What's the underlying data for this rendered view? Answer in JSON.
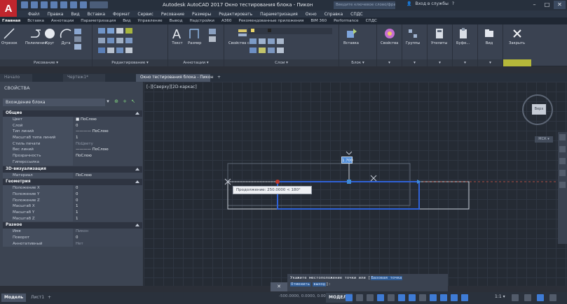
{
  "app": {
    "logo_letter": "A",
    "title": "Autodesk AutoCAD 2017   Окно тестирования блока - Пикон",
    "search_placeholder": "Введите ключевое слово/фразу",
    "signin": "Вход в службы",
    "window_controls": [
      "–",
      "□",
      "✕"
    ]
  },
  "menubar": [
    "Файл",
    "Правка",
    "Вид",
    "Вставка",
    "Формат",
    "Сервис",
    "Рисование",
    "Размеры",
    "Редактировать",
    "Параметризация",
    "Окно",
    "Справка",
    "СПДС"
  ],
  "ribbon_tabs": [
    {
      "label": "Главная",
      "active": true
    },
    {
      "label": "Вставка",
      "active": false
    },
    {
      "label": "Аннотации",
      "active": false
    },
    {
      "label": "Параметризация",
      "active": false
    },
    {
      "label": "Вид",
      "active": false
    },
    {
      "label": "Управление",
      "active": false
    },
    {
      "label": "Вывод",
      "active": false
    },
    {
      "label": "Надстройки",
      "active": false
    },
    {
      "label": "A360",
      "active": false
    },
    {
      "label": "Рекомендованные приложения",
      "active": false
    },
    {
      "label": "BIM 360",
      "active": false
    },
    {
      "label": "Performance",
      "active": false
    },
    {
      "label": "СПДС",
      "active": false
    }
  ],
  "ribbon": {
    "buttons": {
      "line": "Отрезок",
      "polyline": "Полилиния",
      "circle": "Круг",
      "arc": "Дуга",
      "text": "Текст",
      "dimension": "Размер",
      "properties": "Свойства слоя",
      "insert": "Вставка",
      "props_big": "Свойства",
      "groups": "Группы",
      "utilities": "Утилиты",
      "clipboard": "Буфе...",
      "view": "Вид",
      "close": "Закрыть"
    },
    "panels": {
      "draw": "Рисование ▾",
      "modify": "Редактирование ▾",
      "annotation": "Аннотации ▾",
      "layers": "Слои ▾",
      "block": "Блок ▾"
    }
  },
  "filetabs": [
    {
      "label": "Начало",
      "active": false
    },
    {
      "label": "Чертеж1*",
      "active": false
    },
    {
      "label": "Окно тестирования блока - Пикон",
      "active": true
    },
    {
      "label": "+",
      "active": false
    }
  ],
  "properties": {
    "title": "СВОЙСТВА",
    "selector": "Вхождение блока",
    "sections": [
      {
        "name": "Общие",
        "rows": [
          {
            "name": "Цвет",
            "value": "■ ПоСлою"
          },
          {
            "name": "Слой",
            "value": "0"
          },
          {
            "name": "Тип линий",
            "value": "———— ПоСлою"
          },
          {
            "name": "Масштаб типа линий",
            "value": "1"
          },
          {
            "name": "Стиль печати",
            "value": "ПоЦвету",
            "muted": true
          },
          {
            "name": "Вес линий",
            "value": "———— ПоСлою"
          },
          {
            "name": "Прозрачность",
            "value": "ПоСлою"
          },
          {
            "name": "Гиперссылка",
            "value": ""
          }
        ]
      },
      {
        "name": "3D-визуализация",
        "rows": [
          {
            "name": "Материал",
            "value": "ПоСлою"
          }
        ]
      },
      {
        "name": "Геометрия",
        "rows": [
          {
            "name": "Положение X",
            "value": "0"
          },
          {
            "name": "Положение Y",
            "value": "0"
          },
          {
            "name": "Положение Z",
            "value": "0"
          },
          {
            "name": "Масштаб X",
            "value": "1"
          },
          {
            "name": "Масштаб Y",
            "value": "1"
          },
          {
            "name": "Масштаб Z",
            "value": "1"
          }
        ]
      },
      {
        "name": "Разное",
        "rows": [
          {
            "name": "Имя",
            "value": "Пикон",
            "muted": true
          },
          {
            "name": "Поворот",
            "value": "0"
          },
          {
            "name": "Аннотативный",
            "value": "Нет",
            "muted": true
          }
        ]
      }
    ]
  },
  "canvas": {
    "viewport_label": "[–][Сверху][2D-каркас]",
    "tooltip": "Продолжение: 250.0000 < 180°",
    "dim_input": "1.700",
    "viewcube_face": "Верх",
    "wcs": "МСК ▾"
  },
  "command": {
    "line1_prefix": "Укажите местоположение точки или [",
    "opt1": "Базовая точка",
    "line2_prefix": "Отменить",
    "opt2": "выход",
    "line2_suffix": "]:"
  },
  "status": {
    "layouts": [
      {
        "label": "Модель",
        "active": true
      },
      {
        "label": "Лист1",
        "active": false
      },
      {
        "label": "+",
        "active": false
      }
    ],
    "coords": "-500.0000, 0.0000, 0.0000",
    "mode": "МОДЕЛЬ",
    "scale": "1:1 ▾"
  },
  "colors": {
    "accent_blue": "#2f62d8",
    "marker_red": "#c0392b",
    "marker_blue": "#3f8bd8",
    "autocad_red": "#c0262d"
  }
}
